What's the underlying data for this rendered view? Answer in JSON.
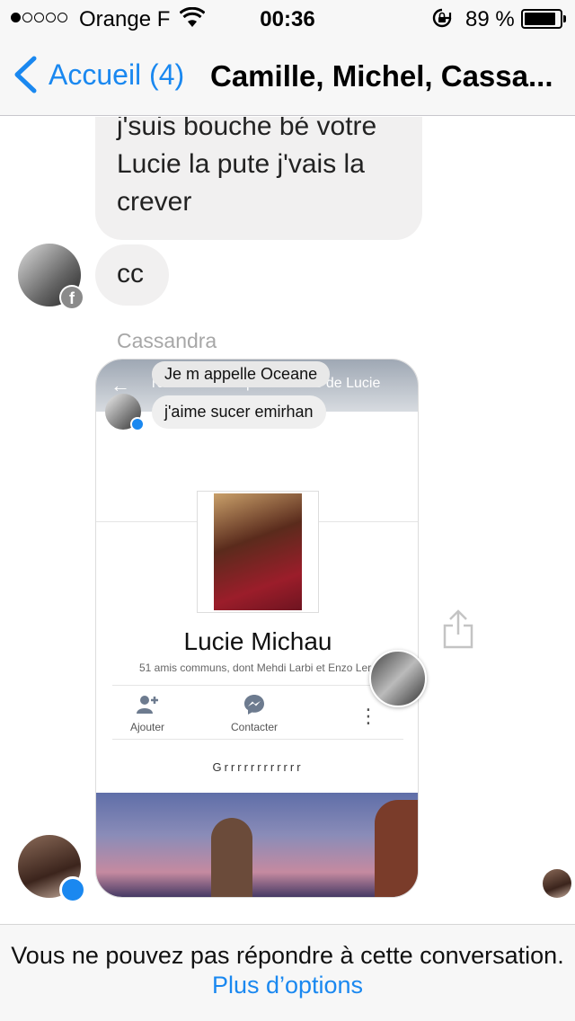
{
  "status_bar": {
    "carrier": "Orange F",
    "time": "00:36",
    "battery_text": "89 %",
    "battery_level": 0.89,
    "signal_bars_filled": 1,
    "signal_bars_total": 5,
    "icons": [
      "wifi-icon",
      "rotation-lock-icon",
      "battery-icon"
    ]
  },
  "nav": {
    "back_label": "Accueil (4)",
    "title": "Camille, Michel, Cassa..."
  },
  "thread": {
    "message_1": "j'suis bouche bé votre Lucie la pute j'vais la crever",
    "message_2": "cc",
    "sender_name": "Cassandra",
    "shared_screenshot": {
      "bubble_top": "Je m appelle Oceane",
      "search_text": "rcher dans les publications de Lucie",
      "bubble_message": "j'aime sucer emirhan",
      "profile_name": "Lucie Michau",
      "mutual_friends": "51 amis communs, dont Mehdi Larbi et Enzo Lero",
      "action_add": "Ajouter",
      "action_contact": "Contacter",
      "more_glyph": "⋮",
      "bio": "Grrrrrrrrrrrr"
    }
  },
  "footer": {
    "text": "Vous ne pouvez pas répondre à cette conversation.",
    "link": "Plus d’options"
  },
  "colors": {
    "accent": "#1a88f0",
    "bubble": "#f1f0f0",
    "bar_background": "#f7f7f7",
    "sender_name": "#a7a7a7"
  }
}
